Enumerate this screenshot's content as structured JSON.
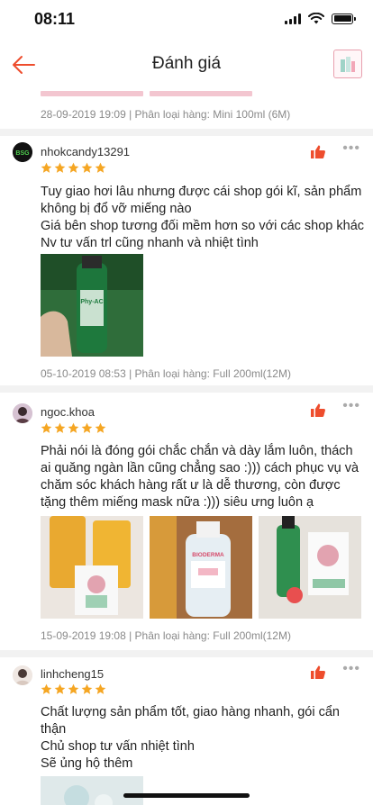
{
  "status": {
    "time": "08:11"
  },
  "nav": {
    "title": "Đánh giá"
  },
  "top_meta": "28-09-2019 19:09 | Phân loại hàng: Mini 100ml (6M)",
  "reviews": [
    {
      "username": "nhokcandy13291",
      "stars": 5,
      "lines": [
        "Tuy giao hơi lâu nhưng được cái shop gói kĩ, sản phẩm",
        "không bị đổ vỡ miếng nào",
        "Giá bên shop tương đối mềm hơn so với các shop khác",
        "Nv tư vấn trl cũng nhanh và nhiệt tình"
      ],
      "meta": "05-10-2019 08:53 | Phân loại hàng: Full 200ml(12M)"
    },
    {
      "username": "ngoc.khoa",
      "stars": 5,
      "lines": [
        "Phải nói là đóng gói chắc chắn và dày lắm luôn, thách",
        "ai quăng ngàn lần cũng chẳng sao :))) cách phục vụ và",
        "chăm sóc khách hàng rất ư là dễ thương, còn được",
        "tặng thêm miếng mask nữa :))) siêu ưng luôn ạ"
      ],
      "meta": "15-09-2019 19:08 | Phân loại hàng: Full 200ml(12M)"
    },
    {
      "username": "linhcheng15",
      "stars": 5,
      "lines": [
        "Chất lượng sản phẩm tốt, giao hàng nhanh, gói cẩn",
        "thận",
        "Chủ shop tư vấn nhiệt tình",
        "Sẽ ủng hộ thêm"
      ]
    }
  ],
  "photo_texts": {
    "bottle1": "Phy-AC",
    "bioderma": "BIODERMA"
  },
  "colors": {
    "accent": "#ee4d2d",
    "star": "#f5a623",
    "meta": "#8a8a8a"
  }
}
